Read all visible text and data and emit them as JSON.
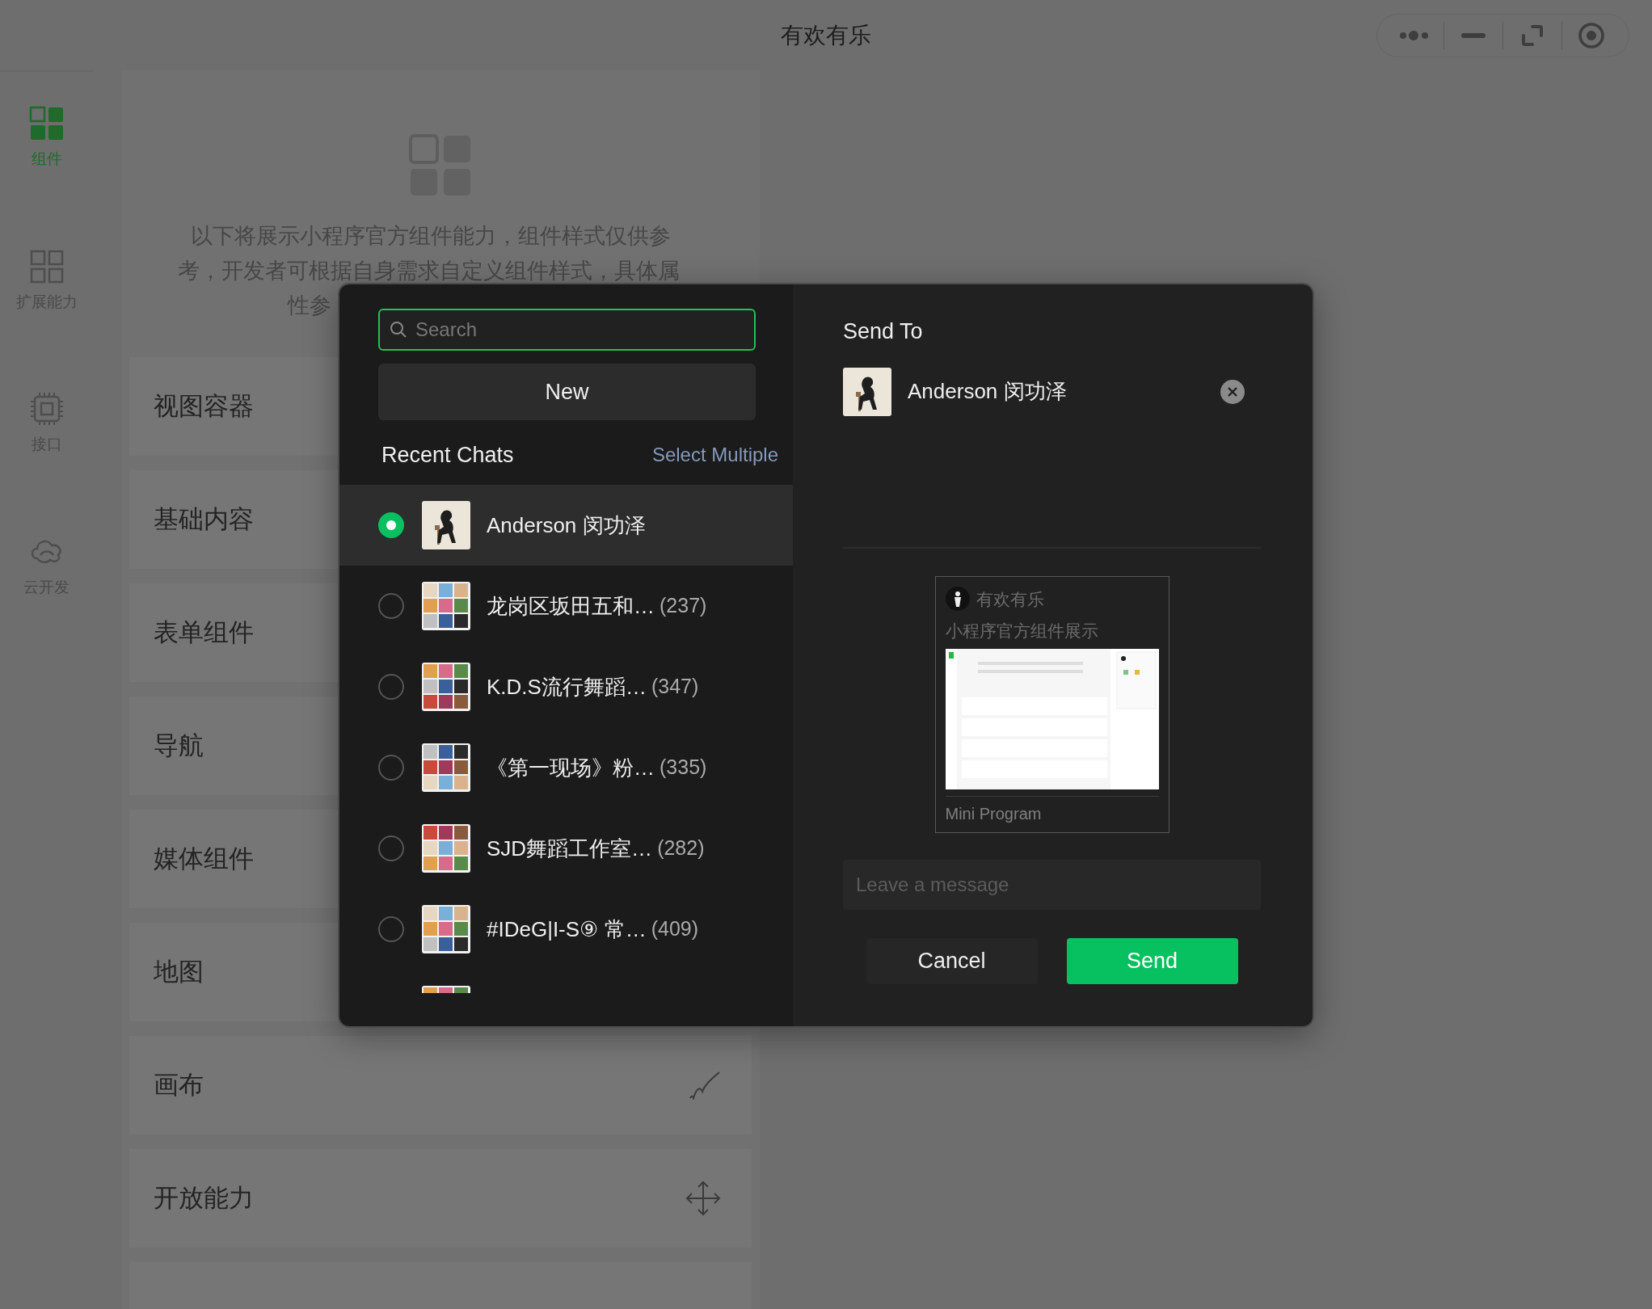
{
  "window": {
    "title": "有欢有乐"
  },
  "rail": [
    {
      "label": "组件",
      "selected": true
    },
    {
      "label": "扩展能力",
      "selected": false
    },
    {
      "label": "接口",
      "selected": false
    },
    {
      "label": "云开发",
      "selected": false
    }
  ],
  "intro": [
    "以下将展示小程序官方组件能力，组件样式仅供参",
    "考，开发者可根据自身需求自定义组件样式，具体属",
    "性参"
  ],
  "categories": [
    {
      "label": "视图容器"
    },
    {
      "label": "基础内容"
    },
    {
      "label": "表单组件"
    },
    {
      "label": "导航"
    },
    {
      "label": "媒体组件"
    },
    {
      "label": "地图"
    },
    {
      "label": "画布"
    },
    {
      "label": "开放能力"
    }
  ],
  "share_dialog": {
    "search": {
      "placeholder": "Search",
      "focused": true
    },
    "new_button": "New",
    "recent_title": "Recent Chats",
    "select_multiple": "Select Multiple",
    "chats": [
      {
        "kind": "chat",
        "name": "Anderson 闵功泽",
        "selected": true
      },
      {
        "kind": "chat",
        "name": "龙岗区坂田五和…",
        "count": "(237)",
        "selected": false
      },
      {
        "kind": "chat",
        "name": "K.D.S流行舞蹈…",
        "count": "(347)",
        "selected": false
      },
      {
        "kind": "chat",
        "name": "《第一现场》粉…",
        "count": "(335)",
        "selected": false
      },
      {
        "kind": "chat",
        "name": "SJD舞蹈工作室…",
        "count": "(282)",
        "selected": false
      },
      {
        "kind": "chat",
        "name": "#IDeG|I-S⑨ 常…",
        "count": "(409)",
        "selected": false
      },
      {
        "kind": "picture"
      }
    ],
    "send_to": {
      "title": "Send To",
      "recipients": [
        {
          "name": "Anderson 闵功泽"
        }
      ]
    },
    "card": {
      "app_name": "有欢有乐",
      "subtitle": "小程序官方组件展示",
      "footer": "Mini Program"
    },
    "message": {
      "placeholder": "Leave a message"
    },
    "buttons": [
      {
        "label": "Cancel",
        "kind": "secondary"
      },
      {
        "label": "Send",
        "kind": "primary"
      }
    ]
  }
}
